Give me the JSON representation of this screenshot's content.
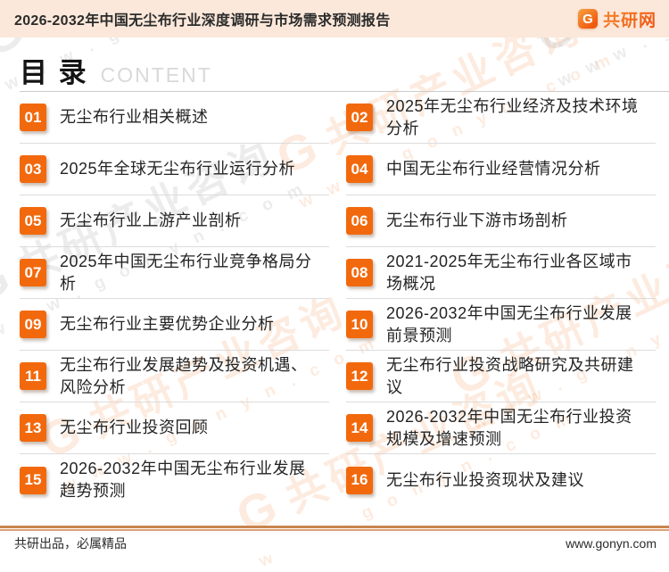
{
  "header": {
    "report_title": "2026-2032年中国无尘布行业深度调研与市场需求预测报告",
    "logo": {
      "icon_letter": "G",
      "brand": "共研网"
    }
  },
  "toc": {
    "title_cn": "目 录",
    "title_en": "CONTENT",
    "items": [
      {
        "num": "01",
        "title": "无尘布行业相关概述"
      },
      {
        "num": "02",
        "title": "2025年无尘布行业经济及技术环境\n分析"
      },
      {
        "num": "03",
        "title": "2025年全球无尘布行业运行分析"
      },
      {
        "num": "04",
        "title": "中国无尘布行业经营情况分析"
      },
      {
        "num": "05",
        "title": "无尘布行业上游产业剖析"
      },
      {
        "num": "06",
        "title": "无尘布行业下游市场剖析"
      },
      {
        "num": "07",
        "title": "2025年中国无尘布行业竞争格局分\n析"
      },
      {
        "num": "08",
        "title": "2021-2025年无尘布行业各区域市\n场概况"
      },
      {
        "num": "09",
        "title": "无尘布行业主要优势企业分析"
      },
      {
        "num": "10",
        "title": "2026-2032年中国无尘布行业发展\n前景预测"
      },
      {
        "num": "11",
        "title": "无尘布行业发展趋势及投资机遇、\n风险分析"
      },
      {
        "num": "12",
        "title": "无尘布行业投资战略研究及共研建\n议"
      },
      {
        "num": "13",
        "title": "无尘布行业投资回顾"
      },
      {
        "num": "14",
        "title": "2026-2032年中国无尘布行业投资\n规模及增速预测"
      },
      {
        "num": "15",
        "title": "2026-2032年中国无尘布行业发展\n趋势预测"
      },
      {
        "num": "16",
        "title": "无尘布行业投资现状及建议"
      }
    ]
  },
  "watermark": {
    "icon_letter": "G",
    "brand_text": "共研产业咨询",
    "url_text": "w w w . g o n y n . c o m"
  },
  "footer": {
    "slogan": "共研出品，必属精品",
    "website": "www.gonyn.com"
  },
  "colors": {
    "accent_orange": "#f2690d",
    "header_bg": "#fbe8da",
    "separator": "#dcdcdc",
    "footer_rule": "#c8854e"
  }
}
